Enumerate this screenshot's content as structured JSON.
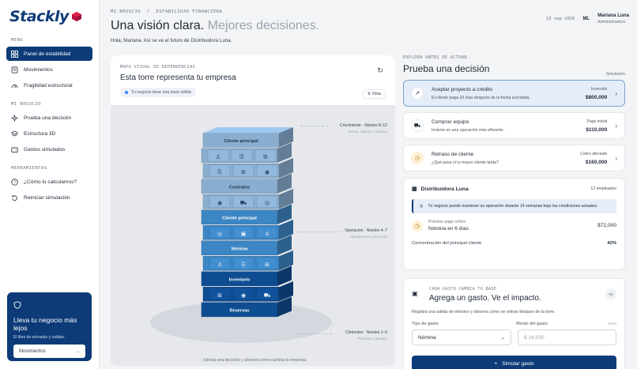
{
  "brand": {
    "name": "Stackly"
  },
  "sidebar": {
    "menu_label": "MENU",
    "menu_items": [
      {
        "label": "Panel de estabilidad",
        "icon": "grid-icon",
        "active": true
      },
      {
        "label": "Movimientos",
        "icon": "list-icon"
      },
      {
        "label": "Fragilidad estructural",
        "icon": "gauge-icon"
      }
    ],
    "business_label": "MI NEGOCIO",
    "business_items": [
      {
        "label": "Prueba una decisión",
        "icon": "sparkle-icon"
      },
      {
        "label": "Estructura 3D",
        "icon": "layers-icon"
      },
      {
        "label": "Gastos simulados",
        "icon": "wallet-icon"
      }
    ],
    "tools_label": "HERRAMIENTAS",
    "tools_items": [
      {
        "label": "¿Cómo lo calculamos?",
        "icon": "help-icon"
      },
      {
        "label": "Reiniciar simulación",
        "icon": "reset-icon"
      }
    ],
    "promo": {
      "title": "Lleva tu negocio más lejos",
      "subtitle": "El libro de entradas y salidas.",
      "input_value": "Movimientos"
    }
  },
  "header": {
    "crumb_1": "MI NEGOCIO",
    "crumb_sep": "/",
    "crumb_2": "ESTABILIDAD FINANCIERA",
    "headline_main": "Una visión clara.",
    "headline_soft": "Mejores decisiones.",
    "greeting": "Hola, Mariana. Así se ve el futuro de Distribuidora Luna.",
    "date": "13 sep 2026",
    "initials": "ML",
    "user_name": "Mariana Luna",
    "user_role": "Administradora"
  },
  "map": {
    "kicker": "MAPA VISUAL DE DEPENDENCIAS",
    "title": "Esta torre representa tu empresa",
    "pill": "Tu negocio tiene una base sólida",
    "vista_label": "Vista",
    "levels": [
      {
        "title": "Crecimiento · Niveles 8–12",
        "sub": "Ventas, clientes y entorno"
      },
      {
        "title": "Operación · Niveles 4–7",
        "sub": "Operaciones y personas"
      },
      {
        "title": "Cimientos · Niveles 1–3",
        "sub": "Finanzas y liquidez"
      }
    ],
    "block_labels": [
      "Cliente principal",
      "Contratos",
      "Cliente principal",
      "Nómina",
      "Inventario",
      "Reservas"
    ],
    "footer": "Simula una decisión y observa cómo cambia tu empresa",
    "colors": {
      "top": "#8aaed0",
      "mid": "#3d86c4",
      "base": "#0f4d92"
    }
  },
  "decisions": {
    "kicker": "EXPLORA ANTES DE ACTUAR",
    "title": "Prueba una decisión",
    "sim_label": "Simulación",
    "options": [
      {
        "title": "Aceptar proyecto a crédito",
        "sub": "El cliente paga 20 días después de la fecha acordada.",
        "tag": "Inversión",
        "value": "$800,000",
        "icon": "trend-icon",
        "selected": true
      },
      {
        "title": "Comprar equipo",
        "sub": "Invierte en una operación más eficiente.",
        "tag": "Pago inicial",
        "value": "$110,000",
        "icon": "truck-icon"
      },
      {
        "title": "Retraso de cliente",
        "sub": "¿Qué pasa si tu mayor cliente tarda?",
        "tag": "Cobro afectado",
        "value": "$160,000",
        "icon": "clock-icon"
      }
    ]
  },
  "company": {
    "name": "Distribuidora Luna",
    "employees": "12 empleados",
    "alert": "Tu negocio puede mantener su operación durante 14 semanas bajo las condiciones actuales.",
    "next_pay_label": "Próximo pago crítico",
    "next_pay_value": "Nómina en 6 días",
    "next_pay_amount": "$72,000",
    "concentration_label": "Concentración del principal cliente",
    "concentration_value": "42%"
  },
  "expense": {
    "kicker": "CADA GASTO CAMBIA TU BASE",
    "title": "Agrega un gasto. Ve el impacto.",
    "badge": "00",
    "desc": "Registra una salida de efectivo y observa cómo se retiran bloques de la torre.",
    "type_label": "Tipo de gasto",
    "amount_label": "Monto del gasto",
    "currency": "MXN",
    "type_value": "Nómina",
    "amount_placeholder": "$ 24,000",
    "button": "Simular gasto"
  }
}
